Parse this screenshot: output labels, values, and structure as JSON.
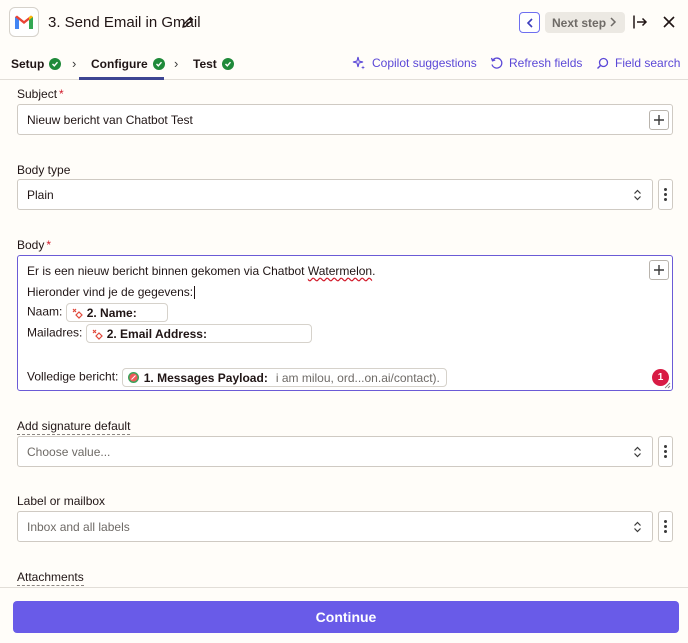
{
  "header": {
    "step_title": "3. Send Email in Gmail",
    "next_label": "Next step"
  },
  "tabs": [
    {
      "label": "Setup",
      "status": "complete"
    },
    {
      "label": "Configure",
      "status": "complete",
      "active": true
    },
    {
      "label": "Test",
      "status": "complete"
    }
  ],
  "tools": {
    "copilot": "Copilot suggestions",
    "refresh": "Refresh fields",
    "search": "Field search"
  },
  "fields": {
    "subject": {
      "label": "Subject",
      "value": "Nieuw bericht van Chatbot Test"
    },
    "body_type": {
      "label": "Body type",
      "value": "Plain"
    },
    "body": {
      "label": "Body",
      "line1_a": "Er is een nieuw bericht binnen gekomen via Chatbot ",
      "line1_b": "Watermelon",
      "line1_c": ".",
      "line2": "Hieronder vind je de gegevens:",
      "naam_label": "Naam:",
      "naam_pill": "2. Name:",
      "mail_label": "Mailadres:",
      "mail_pill": "2. Email Address:",
      "vol_label": "Volledige bericht:",
      "vol_pill": "1. Messages Payload:",
      "vol_sample": "i am milou, ord...on.ai/contact).",
      "error_count": "1"
    },
    "signature": {
      "label": "Add signature default",
      "placeholder": "Choose value..."
    },
    "label_mailbox": {
      "label": "Label or mailbox",
      "value": "Inbox and all labels"
    },
    "attachments": {
      "label": "Attachments"
    }
  },
  "footer": {
    "continue_label": "Continue"
  },
  "colors": {
    "accent": "#695be8",
    "success": "#1f8a3a",
    "error": "#d81b44"
  }
}
